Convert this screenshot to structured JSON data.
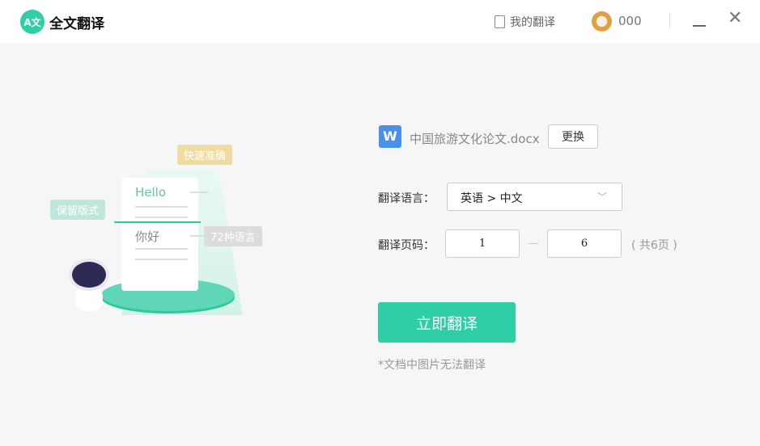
{
  "app": {
    "logo_text": "A文",
    "title": "全文翻译"
  },
  "header": {
    "my_translations": "我的翻译",
    "username": "000"
  },
  "illustration": {
    "tag_fast": "快速准确",
    "tag_layout": "保留版式",
    "tag_langs": "72种语言",
    "hello": "Hello",
    "nihao": "你好"
  },
  "file": {
    "icon_letter": "W",
    "name": "中国旅游文化论文.docx",
    "change_label": "更换"
  },
  "form": {
    "language_label": "翻译语言：",
    "language_value": "英语 > 中文",
    "pages_label": "翻译页码：",
    "page_from": "1",
    "page_to": "6",
    "total_pages": "( 共6页 )"
  },
  "action": {
    "translate_label": "立即翻译",
    "note": "*文档中图片无法翻译"
  }
}
